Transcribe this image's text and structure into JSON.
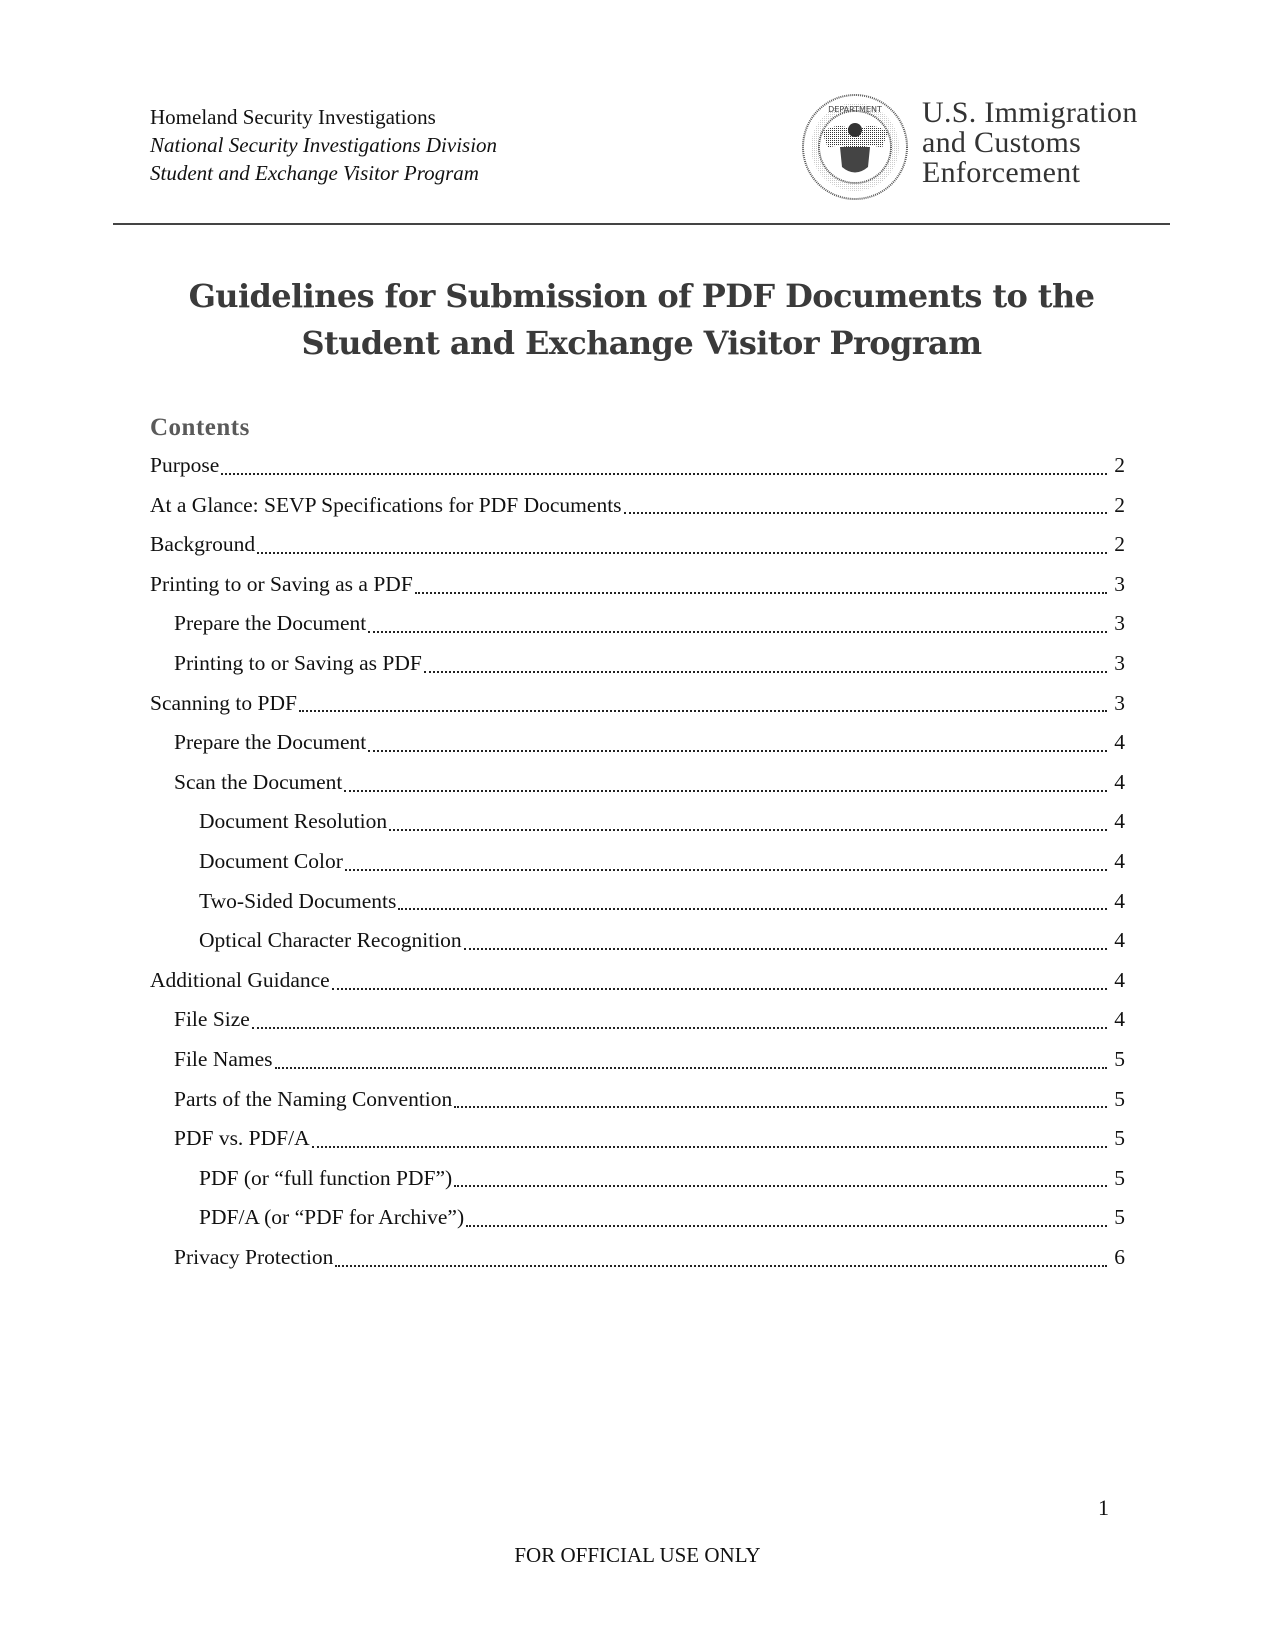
{
  "header": {
    "org_lines": [
      "Homeland Security Investigations",
      "National Security Investigations Division",
      "Student and Exchange Visitor Program"
    ],
    "seal_icon": "dhs-seal-icon",
    "agency_lines": [
      "U.S. Immigration",
      "and Customs",
      "Enforcement"
    ]
  },
  "title": {
    "line1": "Guidelines for Submission of PDF Documents to the",
    "line2": "Student and Exchange Visitor Program"
  },
  "toc": {
    "heading": "Contents",
    "entries": [
      {
        "label": "Purpose",
        "page": "2",
        "level": 1
      },
      {
        "label": "At a Glance: SEVP Specifications for PDF Documents",
        "page": "2",
        "level": 1
      },
      {
        "label": "Background",
        "page": "2",
        "level": 1
      },
      {
        "label": "Printing to or Saving as a PDF",
        "page": "3",
        "level": 1
      },
      {
        "label": "Prepare the Document",
        "page": "3",
        "level": 2
      },
      {
        "label": "Printing to or Saving as PDF",
        "page": "3",
        "level": 2
      },
      {
        "label": "Scanning to PDF",
        "page": "3",
        "level": 1
      },
      {
        "label": "Prepare the Document",
        "page": "4",
        "level": 2
      },
      {
        "label": "Scan the Document",
        "page": "4",
        "level": 2
      },
      {
        "label": "Document Resolution",
        "page": "4",
        "level": 3
      },
      {
        "label": "Document Color",
        "page": "4",
        "level": 3
      },
      {
        "label": "Two-Sided Documents",
        "page": "4",
        "level": 3
      },
      {
        "label": "Optical Character Recognition",
        "page": "4",
        "level": 3
      },
      {
        "label": "Additional Guidance",
        "page": "4",
        "level": 1
      },
      {
        "label": "File Size",
        "page": "4",
        "level": 2
      },
      {
        "label": "File Names",
        "page": "5",
        "level": 2
      },
      {
        "label": "Parts of the Naming Convention",
        "page": "5",
        "level": 2
      },
      {
        "label": "PDF vs. PDF/A",
        "page": "5",
        "level": 2
      },
      {
        "label": "PDF (or “full function PDF”)",
        "page": "5",
        "level": 3
      },
      {
        "label": "PDF/A (or “PDF for Archive”)",
        "page": "5",
        "level": 3
      },
      {
        "label": "Privacy Protection",
        "page": "6",
        "level": 2
      }
    ]
  },
  "page_number": "1",
  "footer": "FOR OFFICIAL USE ONLY"
}
